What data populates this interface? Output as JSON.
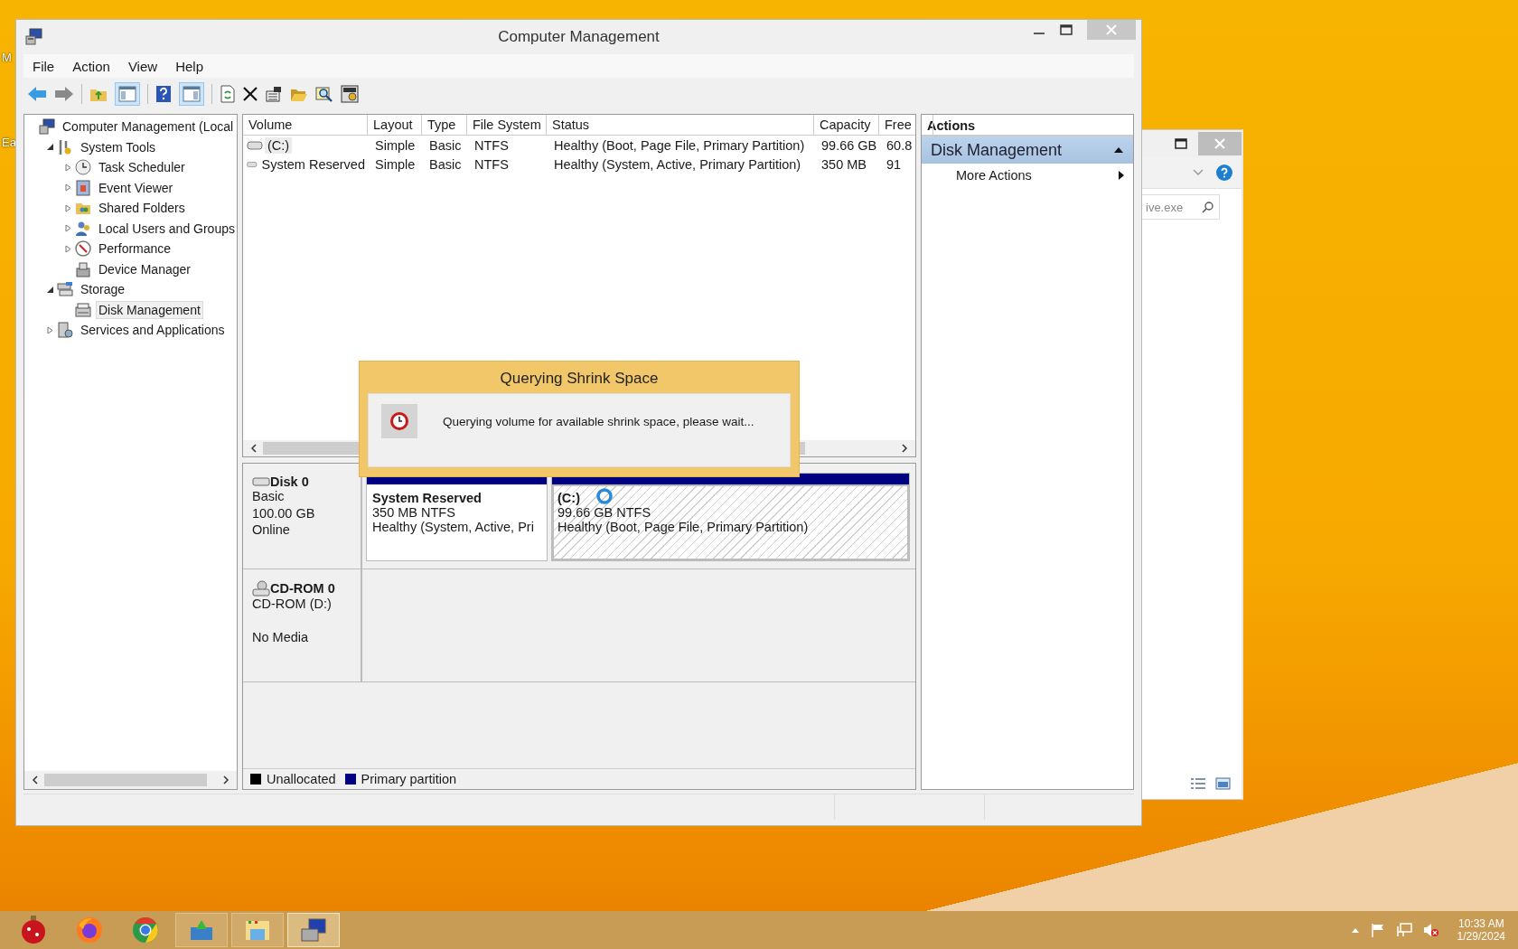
{
  "desktop_labels": [
    "M",
    "Ea"
  ],
  "window": {
    "title": "Computer Management",
    "menu": [
      "File",
      "Action",
      "View",
      "Help"
    ]
  },
  "tree": [
    {
      "label": "Computer Management (Local",
      "selected": false,
      "children": [
        {
          "label": "System Tools",
          "expanded": true,
          "selected": false,
          "children": [
            {
              "label": "Task Scheduler",
              "expanded": false,
              "selected": false
            },
            {
              "label": "Event Viewer",
              "expanded": false,
              "selected": false
            },
            {
              "label": "Shared Folders",
              "expanded": false,
              "selected": false
            },
            {
              "label": "Local Users and Groups",
              "expanded": false,
              "selected": false
            },
            {
              "label": "Performance",
              "expanded": false,
              "selected": false
            },
            {
              "label": "Device Manager",
              "selected": false
            }
          ]
        },
        {
          "label": "Storage",
          "expanded": true,
          "selected": false,
          "children": [
            {
              "label": "Disk Management",
              "selected": true
            }
          ]
        },
        {
          "label": "Services and Applications",
          "expanded": false,
          "selected": false
        }
      ]
    }
  ],
  "volumes": {
    "columns": [
      "Volume",
      "Layout",
      "Type",
      "File System",
      "Status",
      "Capacity",
      "Free"
    ],
    "rows": [
      {
        "selected": true,
        "cells": [
          "(C:)",
          "Simple",
          "Basic",
          "NTFS",
          "Healthy (Boot, Page File, Primary Partition)",
          "99.66 GB",
          "60.8"
        ]
      },
      {
        "selected": false,
        "cells": [
          "System Reserved",
          "Simple",
          "Basic",
          "NTFS",
          "Healthy (System, Active, Primary Partition)",
          "350 MB",
          "91"
        ]
      }
    ]
  },
  "disks": [
    {
      "kind": "disk",
      "name": "Disk 0",
      "lines": [
        "Basic",
        "100.00 GB"
      ],
      "status": "Online",
      "partitions": [
        {
          "name": "System Reserved",
          "size": "350 MB NTFS",
          "status": "Healthy (System, Active, Pri",
          "kind": "primary",
          "selected": false
        },
        {
          "name": "(C:)",
          "size": "99.66 GB NTFS",
          "status": "Healthy (Boot, Page File, Primary Partition)",
          "kind": "primary",
          "selected": true
        }
      ]
    },
    {
      "kind": "cdrom",
      "name": "CD-ROM 0",
      "lines": [
        "CD-ROM (D:)"
      ],
      "status": "No Media"
    }
  ],
  "legend": [
    {
      "label": "Unallocated",
      "color": "#000000"
    },
    {
      "label": "Primary partition",
      "color": "#000080"
    }
  ],
  "actions": {
    "title": "Actions",
    "section": "Disk Management",
    "expanded": true,
    "items": [
      "More Actions"
    ]
  },
  "dialog": {
    "title": "Querying Shrink Space",
    "message": "Querying volume for available shrink space, please wait..."
  },
  "back_window": {
    "search": "ive.exe"
  },
  "taskbar": {
    "apps": [
      {
        "kind": "ornament",
        "running": false,
        "selected": false
      },
      {
        "kind": "firefox",
        "running": false,
        "selected": false
      },
      {
        "kind": "chrome",
        "running": false,
        "selected": false
      },
      {
        "kind": "download",
        "running": true,
        "selected": false
      },
      {
        "kind": "explorer",
        "running": true,
        "selected": false
      },
      {
        "kind": "compmgmt",
        "running": true,
        "selected": true
      }
    ],
    "time": "10:33 AM",
    "date": "1/29/2024"
  }
}
